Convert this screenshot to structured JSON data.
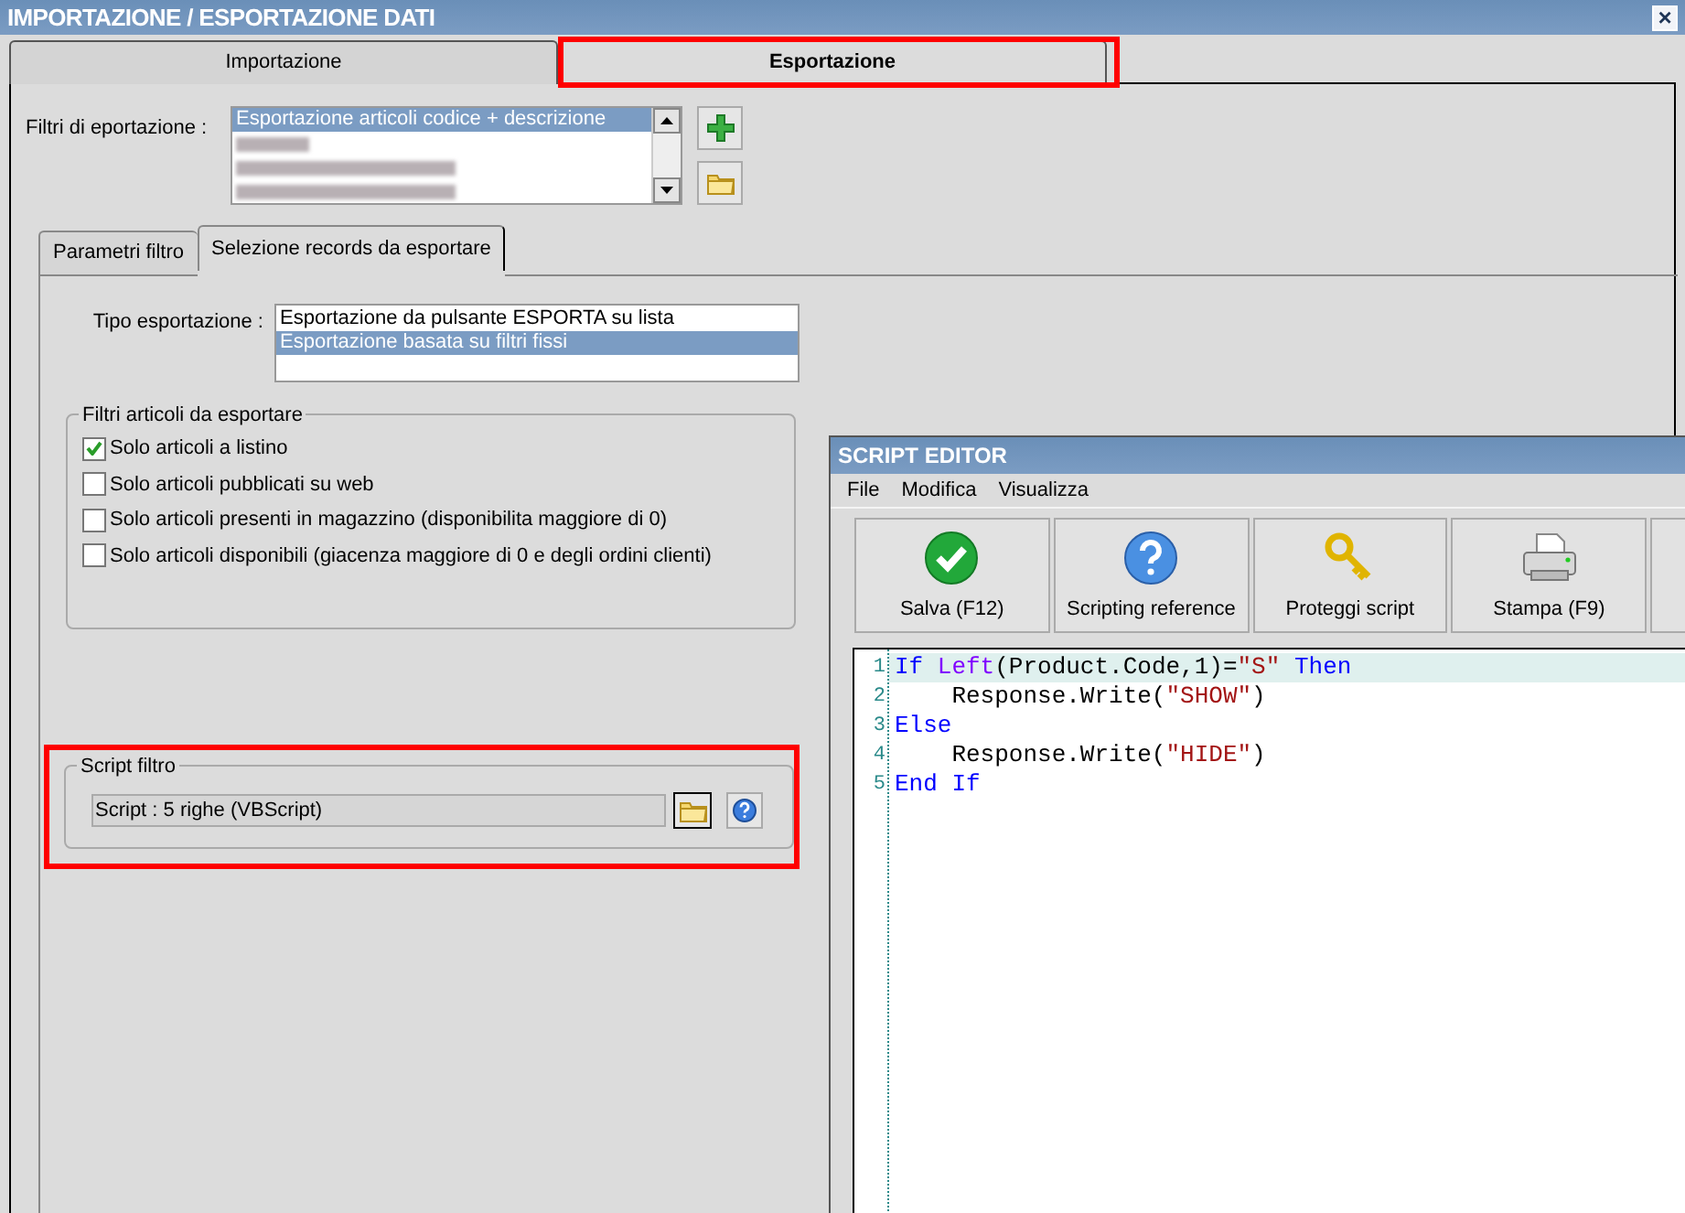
{
  "window": {
    "title": "IMPORTAZIONE / ESPORTAZIONE DATI",
    "close": "×"
  },
  "tabs": [
    {
      "label": "Importazione",
      "selected": false
    },
    {
      "label": "Esportazione",
      "selected": true
    }
  ],
  "export_filters": {
    "label": "Filtri di eportazione :",
    "items": [
      {
        "text": "Esportazione articoli codice + descrizione",
        "selected": true,
        "kind": "text"
      },
      {
        "kind": "blurred",
        "selected": false
      },
      {
        "kind": "blurred",
        "selected": false
      },
      {
        "kind": "blurred",
        "selected": false
      }
    ]
  },
  "subtabs": [
    {
      "label": "Parametri filtro",
      "selected": false
    },
    {
      "label": "Selezione records da esportare",
      "selected": true
    }
  ],
  "export_type": {
    "label": "Tipo esportazione :",
    "items": [
      {
        "text": "Esportazione da pulsante ESPORTA su lista",
        "selected": false
      },
      {
        "text": "Esportazione basata su filtri fissi",
        "selected": true
      }
    ]
  },
  "article_filters": {
    "title": "Filtri articoli da esportare",
    "items": [
      {
        "label": "Solo articoli a listino",
        "checked": true
      },
      {
        "label": "Solo articoli pubblicati su web",
        "checked": false
      },
      {
        "label": "Solo articoli presenti in magazzino (disponibilita maggiore di 0)",
        "checked": false
      },
      {
        "label": "Solo articoli disponibili (giacenza maggiore di 0 e degli ordini clienti)",
        "checked": false
      }
    ]
  },
  "script_filter": {
    "title": "Script filtro",
    "value": "Script : 5 righe (VBScript)"
  },
  "script_editor": {
    "title": "SCRIPT EDITOR",
    "menu": [
      "File",
      "Modifica",
      "Visualizza"
    ],
    "toolbar": [
      {
        "label": "Salva (F12)",
        "kind": "check"
      },
      {
        "label": "Scripting reference",
        "kind": "help"
      },
      {
        "label": "Proteggi script",
        "kind": "key"
      },
      {
        "label": "Stampa (F9)",
        "kind": "printer"
      }
    ],
    "lines": [
      {
        "number": "1",
        "selected": true,
        "tokens": [
          {
            "text": "If ",
            "kind": "keyword"
          },
          {
            "text": "Left",
            "kind": "function"
          },
          {
            "text": "(Product.Code,1)=",
            "kind": "plain"
          },
          {
            "text": "\"S\" ",
            "kind": "string"
          },
          {
            "text": "Then",
            "kind": "keyword"
          }
        ]
      },
      {
        "number": "2",
        "selected": false,
        "tokens": [
          {
            "text": "    Response.Write(",
            "kind": "plain"
          },
          {
            "text": "\"SHOW\"",
            "kind": "string"
          },
          {
            "text": ")",
            "kind": "plain"
          }
        ]
      },
      {
        "number": "3",
        "selected": false,
        "tokens": [
          {
            "text": "Else",
            "kind": "keyword"
          }
        ]
      },
      {
        "number": "4",
        "selected": false,
        "tokens": [
          {
            "text": "    Response.Write(",
            "kind": "plain"
          },
          {
            "text": "\"HIDE\"",
            "kind": "string"
          },
          {
            "text": ")",
            "kind": "plain"
          }
        ]
      },
      {
        "number": "5",
        "selected": false,
        "tokens": [
          {
            "text": "End If",
            "kind": "keyword"
          }
        ]
      }
    ]
  }
}
